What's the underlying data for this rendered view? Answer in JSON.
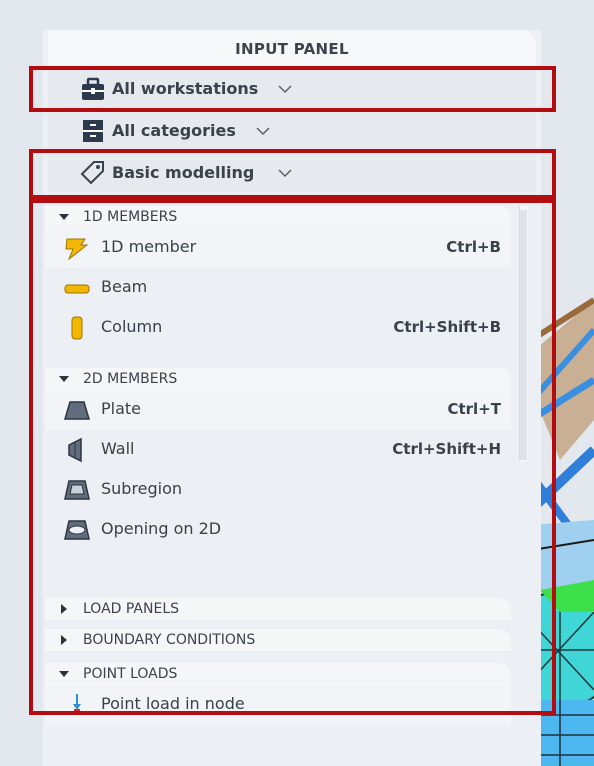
{
  "panel": {
    "title": "INPUT PANEL"
  },
  "filters": [
    {
      "label": "All workstations",
      "icon": "toolbox-icon"
    },
    {
      "label": "All categories",
      "icon": "categories-icon"
    },
    {
      "label": "Basic modelling",
      "icon": "tag-icon"
    }
  ],
  "sections": [
    {
      "title": "1D MEMBERS",
      "expanded": true,
      "items": [
        {
          "name": "1D member",
          "shortcut": "Ctrl+B",
          "icon": "1d-member-icon"
        },
        {
          "name": "Beam",
          "shortcut": "",
          "icon": "beam-icon"
        },
        {
          "name": "Column",
          "shortcut": "Ctrl+Shift+B",
          "icon": "column-icon"
        }
      ]
    },
    {
      "title": "2D MEMBERS",
      "expanded": true,
      "items": [
        {
          "name": "Plate",
          "shortcut": "Ctrl+T",
          "icon": "plate-icon"
        },
        {
          "name": "Wall",
          "shortcut": "Ctrl+Shift+H",
          "icon": "wall-icon"
        },
        {
          "name": "Subregion",
          "shortcut": "",
          "icon": "subregion-icon"
        },
        {
          "name": "Opening on 2D",
          "shortcut": "",
          "icon": "opening-icon"
        }
      ]
    },
    {
      "title": "LOAD PANELS",
      "expanded": false,
      "items": []
    },
    {
      "title": "BOUNDARY CONDITIONS",
      "expanded": false,
      "items": []
    },
    {
      "title": "POINT LOADS",
      "expanded": true,
      "items": [
        {
          "name": "Point load in node",
          "shortcut": "",
          "icon": "point-load-icon"
        }
      ]
    }
  ],
  "colors": {
    "highlight": "#b30d12",
    "accent": "#f2b700",
    "panel": "#eceff3"
  }
}
